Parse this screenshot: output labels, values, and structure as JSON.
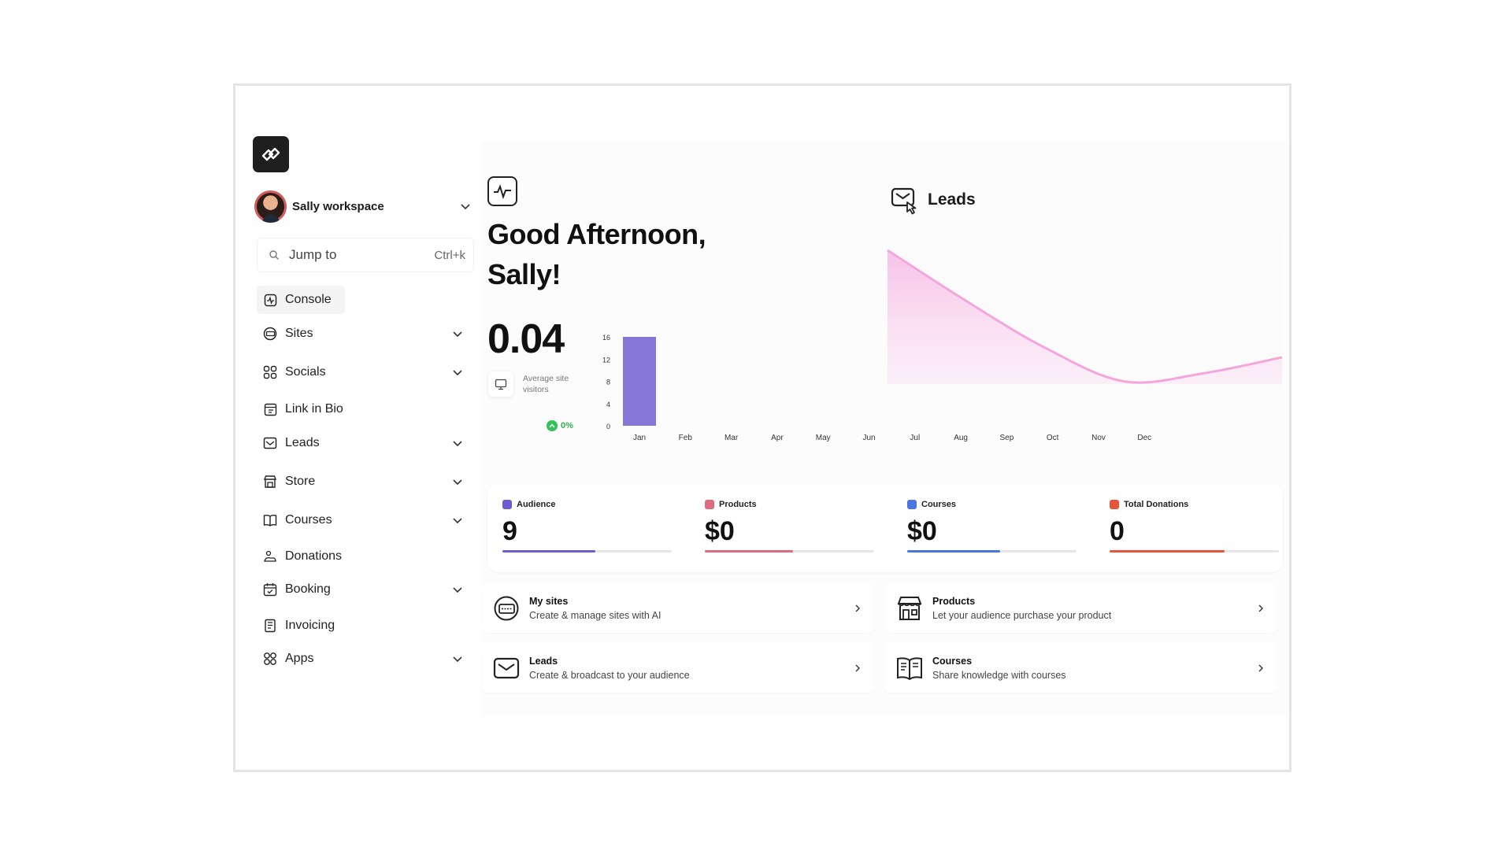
{
  "workspace": {
    "name": "Sally workspace"
  },
  "search": {
    "placeholder": "Jump to",
    "shortcut": "Ctrl+k"
  },
  "sidebar": {
    "items": [
      {
        "label": "Console",
        "icon": "console-icon",
        "expandable": false,
        "active": true
      },
      {
        "label": "Sites",
        "icon": "sites-icon",
        "expandable": true
      },
      {
        "label": "Socials",
        "icon": "socials-icon",
        "expandable": true
      },
      {
        "label": "Link in Bio",
        "icon": "link-in-bio-icon",
        "expandable": false
      },
      {
        "label": "Leads",
        "icon": "leads-icon",
        "expandable": true
      },
      {
        "label": "Store",
        "icon": "store-icon",
        "expandable": true
      },
      {
        "label": "Courses",
        "icon": "courses-icon",
        "expandable": true
      },
      {
        "label": "Donations",
        "icon": "donations-icon",
        "expandable": false
      },
      {
        "label": "Booking",
        "icon": "booking-icon",
        "expandable": true
      },
      {
        "label": "Invoicing",
        "icon": "invoicing-icon",
        "expandable": false
      },
      {
        "label": "Apps",
        "icon": "apps-icon",
        "expandable": true
      }
    ]
  },
  "main": {
    "greeting_line1": "Good Afternoon,",
    "greeting_line2": "Sally!",
    "metric_value": "0.04",
    "metric_label": "Average site visitors",
    "trend": "0%",
    "leads_title": "Leads"
  },
  "chart_data": [
    {
      "type": "bar",
      "categories": [
        "Jan",
        "Feb",
        "Mar",
        "Apr",
        "May",
        "Jun",
        "Jul",
        "Aug",
        "Sep",
        "Oct",
        "Nov",
        "Dec"
      ],
      "values": [
        16,
        0,
        0,
        0,
        0,
        0,
        0,
        0,
        0,
        0,
        0,
        0
      ],
      "yticks": [
        "16",
        "12",
        "8",
        "4",
        "0"
      ],
      "ylim": [
        0,
        16
      ],
      "color": "#8576d8"
    },
    {
      "type": "area",
      "series": [
        {
          "values": [
            1.0,
            0.62,
            0.27,
            0.02,
            0.08,
            0.2
          ]
        }
      ],
      "color": "#f3a5dc"
    }
  ],
  "stats": [
    {
      "label": "Audience",
      "value": "9",
      "color": "#6d5bd6",
      "progress": 0.55
    },
    {
      "label": "Products",
      "value": "$0",
      "color": "#e06a80",
      "progress": 0.52
    },
    {
      "label": "Courses",
      "value": "$0",
      "color": "#4a74e0",
      "progress": 0.55
    },
    {
      "label": "Total Donations",
      "value": "0",
      "color": "#e8553a",
      "progress": 0.68
    }
  ],
  "cards": [
    {
      "title": "My sites",
      "subtitle": "Create & manage sites with AI",
      "icon": "globe-icon"
    },
    {
      "title": "Products",
      "subtitle": "Let your audience purchase your product",
      "icon": "storefront-icon"
    },
    {
      "title": "Leads",
      "subtitle": "Create & broadcast to your audience",
      "icon": "envelope-icon"
    },
    {
      "title": "Courses",
      "subtitle": "Share knowledge with courses",
      "icon": "book-icon"
    }
  ]
}
